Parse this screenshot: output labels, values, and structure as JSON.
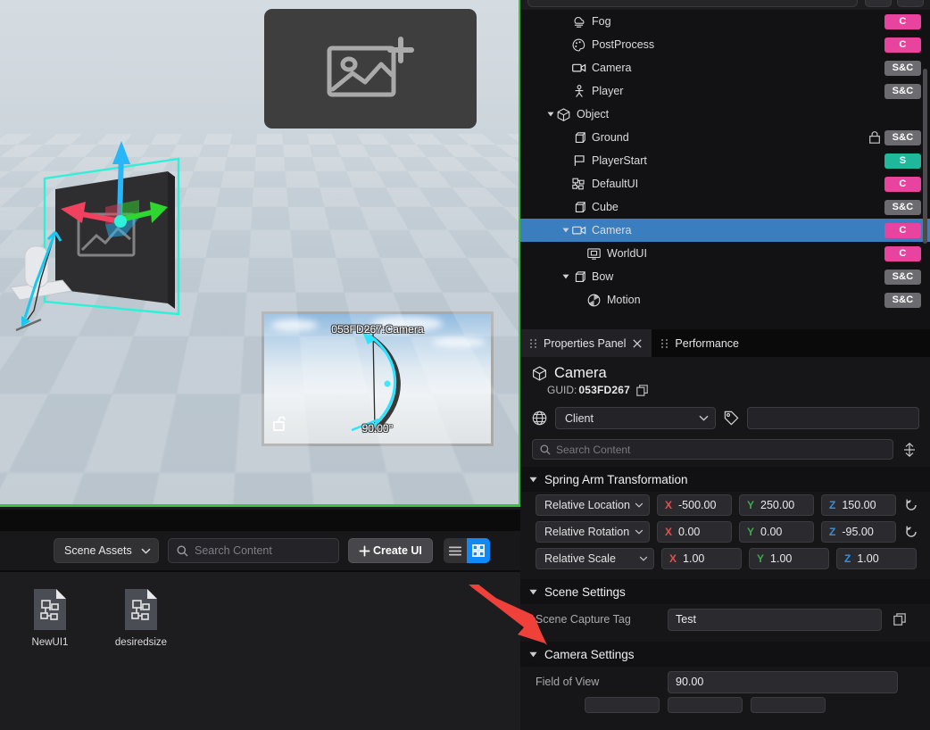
{
  "viewport": {
    "add_image_card_icon": "add-image-icon",
    "camera_preview": {
      "label": "053FD267:Camera",
      "fov_label": "90.00°",
      "lock_icon": "unlock-icon"
    },
    "gizmo": {
      "axis_x_color": "#f0415f",
      "axis_y_color": "#2fd62f",
      "axis_z_color": "#29b6f6",
      "selection_color": "#2ff0d8"
    },
    "border_color": "#3fbf46"
  },
  "asset_browser": {
    "dropdown_label": "Scene Assets",
    "search_placeholder": "Search Content",
    "create_button": "Create UI",
    "view_list_icon": "list-view-icon",
    "view_grid_icon": "grid-view-icon",
    "active_view": "grid",
    "items": [
      {
        "name": "NewUI1",
        "icon": "ui-file-icon"
      },
      {
        "name": "desiredsize",
        "icon": "ui-file-icon"
      }
    ]
  },
  "outliner": {
    "rows": [
      {
        "label": "Fog",
        "icon": "fog-icon",
        "indent": 2,
        "twisty": "",
        "badge": "C",
        "badge_kind": "c",
        "lock": false,
        "selected": false
      },
      {
        "label": "PostProcess",
        "icon": "palette-icon",
        "indent": 2,
        "twisty": "",
        "badge": "C",
        "badge_kind": "c",
        "lock": false,
        "selected": false
      },
      {
        "label": "Camera",
        "icon": "camera-icon",
        "indent": 2,
        "twisty": "",
        "badge": "S&C",
        "badge_kind": "sc",
        "lock": false,
        "selected": false
      },
      {
        "label": "Player",
        "icon": "player-icon",
        "indent": 2,
        "twisty": "",
        "badge": "S&C",
        "badge_kind": "sc",
        "lock": false,
        "selected": false
      },
      {
        "label": "Object",
        "icon": "cube-icon",
        "indent": 1,
        "twisty": "open",
        "badge": "",
        "badge_kind": "",
        "lock": false,
        "selected": false
      },
      {
        "label": "Ground",
        "icon": "box-icon",
        "indent": 2,
        "twisty": "",
        "badge": "S&C",
        "badge_kind": "sc",
        "lock": true,
        "selected": false
      },
      {
        "label": "PlayerStart",
        "icon": "flag-icon",
        "indent": 2,
        "twisty": "",
        "badge": "S",
        "badge_kind": "s",
        "lock": false,
        "selected": false
      },
      {
        "label": "DefaultUI",
        "icon": "ui-widget-icon",
        "indent": 2,
        "twisty": "",
        "badge": "C",
        "badge_kind": "c",
        "lock": false,
        "selected": false
      },
      {
        "label": "Cube",
        "icon": "box-icon",
        "indent": 2,
        "twisty": "",
        "badge": "S&C",
        "badge_kind": "sc",
        "lock": false,
        "selected": false
      },
      {
        "label": "Camera",
        "icon": "camera-icon",
        "indent": 2,
        "twisty": "open",
        "badge": "C",
        "badge_kind": "c",
        "lock": false,
        "selected": true
      },
      {
        "label": "WorldUI",
        "icon": "worldui-icon",
        "indent": 3,
        "twisty": "",
        "badge": "C",
        "badge_kind": "c",
        "lock": false,
        "selected": false
      },
      {
        "label": "Bow",
        "icon": "box-icon",
        "indent": 2,
        "twisty": "open",
        "badge": "S&C",
        "badge_kind": "sc",
        "lock": false,
        "selected": false
      },
      {
        "label": "Motion",
        "icon": "motion-icon",
        "indent": 3,
        "twisty": "",
        "badge": "S&C",
        "badge_kind": "sc",
        "lock": false,
        "selected": false
      }
    ]
  },
  "tabs": [
    {
      "label": "Properties Panel",
      "active": true,
      "closable": true
    },
    {
      "label": "Performance",
      "active": false,
      "closable": false
    }
  ],
  "properties": {
    "object_name": "Camera",
    "object_icon": "cube-icon",
    "guid_label": "GUID:",
    "guid_value": "053FD267",
    "copy_icon": "copy-icon",
    "network_icon": "globe-icon",
    "network_value": "Client",
    "tag_icon": "tag-icon",
    "tag_value": "",
    "search_placeholder": "Search Content",
    "expand_collapse_icon": "expand-collapse-icon",
    "sections": {
      "spring_arm": {
        "title": "Spring Arm Transformation",
        "rows": [
          {
            "select": "Relative Location",
            "x": "-500.00",
            "y": "250.00",
            "z": "150.00",
            "reset": true
          },
          {
            "select": "Relative Rotation",
            "x": "0.00",
            "y": "0.00",
            "z": "-95.00",
            "reset": true
          },
          {
            "select": "Relative Scale",
            "x": "1.00",
            "y": "1.00",
            "z": "1.00",
            "reset": false
          }
        ]
      },
      "scene_settings": {
        "title": "Scene Settings",
        "capture_tag_label": "Scene Capture Tag",
        "capture_tag_value": "Test",
        "copy_icon": "copy-icon"
      },
      "camera_settings": {
        "title": "Camera Settings",
        "fov_label": "Field of View",
        "fov_value": "90.00"
      }
    }
  },
  "colors": {
    "badge_c": "#e8439e",
    "badge_sc": "#6b6b70",
    "badge_s": "#1fb89b",
    "selection": "#3a7ebf",
    "accent_blue": "#1288f5",
    "axis_x": "#e05050",
    "axis_y": "#3fa84e",
    "axis_z": "#3d8fd1",
    "annotation_arrow": "#f0403a"
  }
}
